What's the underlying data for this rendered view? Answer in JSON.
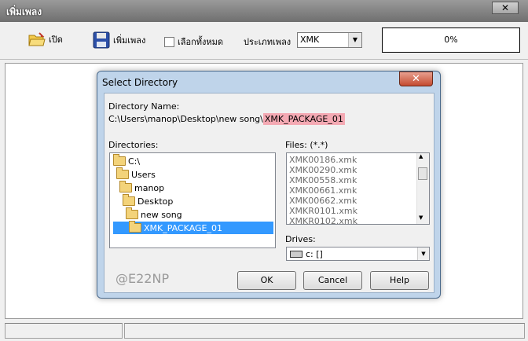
{
  "window": {
    "title": "เพิ่มเพลง",
    "close_label": "✕"
  },
  "toolbar": {
    "open_label": "เปิด",
    "add_song_label": "เพิ่มเพลง",
    "select_all_label": "เลือกทั้งหมด",
    "song_type_label": "ประเภทเพลง",
    "song_type_value": "XMK",
    "progress_text": "0%"
  },
  "dialog": {
    "title": "Select Directory",
    "close_label": "✕",
    "directory_name_label": "Directory Name:",
    "path_prefix": "C:\\Users\\manop\\Desktop\\new song\\",
    "path_highlight": "XMK_PACKAGE_01",
    "directories_label": "Directories:",
    "directories": [
      "C:\\",
      "Users",
      "manop",
      "Desktop",
      "new song",
      "XMK_PACKAGE_01"
    ],
    "files_label": "Files: (*.*)",
    "files": [
      "XMK00186.xmk",
      "XMK00290.xmk",
      "XMK00558.xmk",
      "XMK00661.xmk",
      "XMK00662.xmk",
      "XMKR0101.xmk",
      "XMKR0102.xmk"
    ],
    "drives_label": "Drives:",
    "drive_value": "c: []",
    "ok_label": "OK",
    "cancel_label": "Cancel",
    "help_label": "Help",
    "watermark": "@E22NP"
  },
  "colors": {
    "selection": "#3399ff",
    "path_highlight": "#f4a9b3",
    "dialog_frame": "#bfd4ea"
  }
}
